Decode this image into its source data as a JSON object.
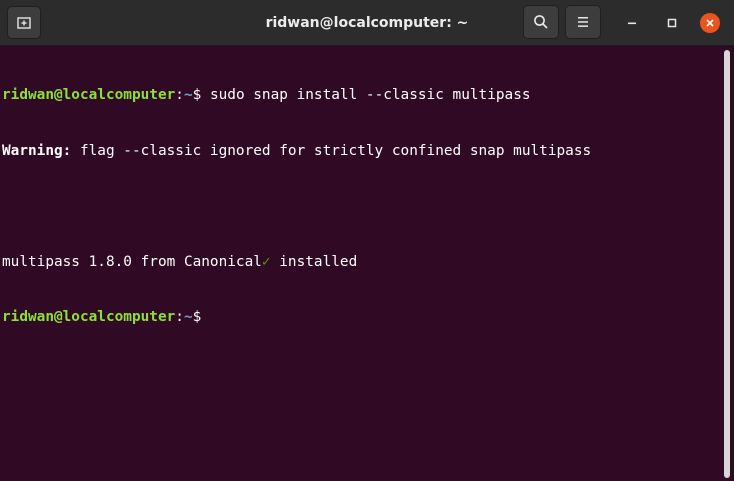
{
  "window": {
    "title": "ridwan@localcomputer: ~"
  },
  "colors": {
    "terminal_bg": "#300a24",
    "titlebar_bg": "#2c2c2c",
    "prompt_user": "#8ae234",
    "prompt_path": "#729fcf",
    "checkmark": "#4e9a06",
    "close_button": "#e95420"
  },
  "icons": {
    "new_tab": "new-tab-icon",
    "search": "search-icon",
    "menu": "hamburger-menu-icon",
    "minimize": "minimize-icon",
    "maximize": "maximize-icon",
    "close": "close-icon"
  },
  "terminal": {
    "line1": {
      "prompt_user": "ridwan@localcomputer",
      "prompt_sep": ":",
      "prompt_path": "~",
      "prompt_symbol": "$ ",
      "command": "sudo snap install --classic multipass"
    },
    "line2": {
      "label": "Warning:",
      "message": " flag --classic ignored for strictly confined snap multipass"
    },
    "line3": "",
    "line4": {
      "text": "multipass 1.8.0 from Canonical",
      "check": "✓",
      "suffix": " installed"
    },
    "line5": {
      "prompt_user": "ridwan@localcomputer",
      "prompt_sep": ":",
      "prompt_path": "~",
      "prompt_symbol": "$"
    }
  }
}
